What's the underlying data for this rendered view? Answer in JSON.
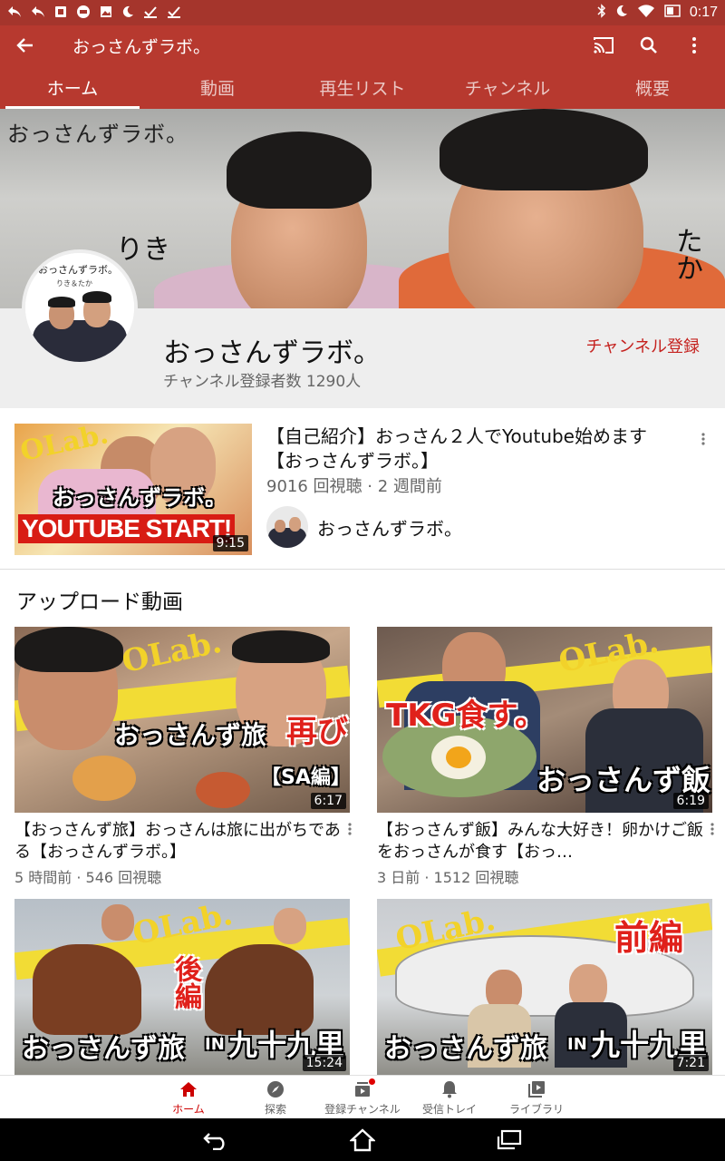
{
  "status_bar": {
    "time": "0:17"
  },
  "toolbar": {
    "title": "おっさんずラボ。"
  },
  "tabs": [
    {
      "label": "ホーム",
      "active": true
    },
    {
      "label": "動画",
      "active": false
    },
    {
      "label": "再生リスト",
      "active": false
    },
    {
      "label": "チャンネル",
      "active": false
    },
    {
      "label": "概要",
      "active": false
    }
  ],
  "banner": {
    "text": "おっさんずラボ。",
    "name_left": "りき",
    "name_right": "たか"
  },
  "channel": {
    "name": "おっさんずラボ。",
    "subscribers": "チャンネル登録者数 1290人",
    "subscribe_label": "チャンネル登録",
    "avatar_text": "おっさんずラボ。",
    "avatar_subtext": "りき＆たか"
  },
  "featured": {
    "title": "【自己紹介】おっさん２人でYoutube始めます【おっさんずラボ。】",
    "meta": "9016 回視聴 · 2 週間前",
    "channel_name": "おっさんずラボ。",
    "duration": "9:15",
    "thumb_olab": "OLab.",
    "thumb_text1": "おっさんずラボ。",
    "thumb_text2": "YOUTUBE START!"
  },
  "section": {
    "title": "アップロード動画"
  },
  "videos": [
    {
      "title": "【おっさんず旅】おっさんは旅に出がちである【おっさんずラボ。】",
      "meta": "5 時間前 · 546 回視聴",
      "duration": "6:17",
      "thumb_olab": "OLab.",
      "thumb_text": "おっさんず旅",
      "thumb_accent": "再び",
      "thumb_tag": "【SA編】"
    },
    {
      "title": "【おっさんず飯】みんな大好き！卵かけご飯をおっさんが食す【おっ…",
      "meta": "3 日前 · 1512 回視聴",
      "duration": "6:19",
      "thumb_olab": "OLab.",
      "thumb_text": "おっさんず飯",
      "thumb_accent": "TKG食す。"
    },
    {
      "duration": "15:24",
      "thumb_olab": "OLab.",
      "thumb_text": "おっさんず旅",
      "thumb_in": "IN",
      "thumb_place": "九十九里",
      "thumb_accent": "後編"
    },
    {
      "duration": "7:21",
      "thumb_olab": "OLab.",
      "thumb_text": "おっさんず旅",
      "thumb_in": "IN",
      "thumb_place": "九十九里",
      "thumb_accent": "前編"
    }
  ],
  "bottom_nav": [
    {
      "label": "ホーム",
      "icon": "home-icon",
      "active": true
    },
    {
      "label": "探索",
      "icon": "explore-icon",
      "active": false
    },
    {
      "label": "登録チャンネル",
      "icon": "subscriptions-icon",
      "active": false
    },
    {
      "label": "受信トレイ",
      "icon": "bell-icon",
      "active": false
    },
    {
      "label": "ライブラリ",
      "icon": "library-icon",
      "active": false
    }
  ],
  "colors": {
    "header": "#b7392f",
    "status": "#a5352c",
    "accent": "#cc0000"
  }
}
